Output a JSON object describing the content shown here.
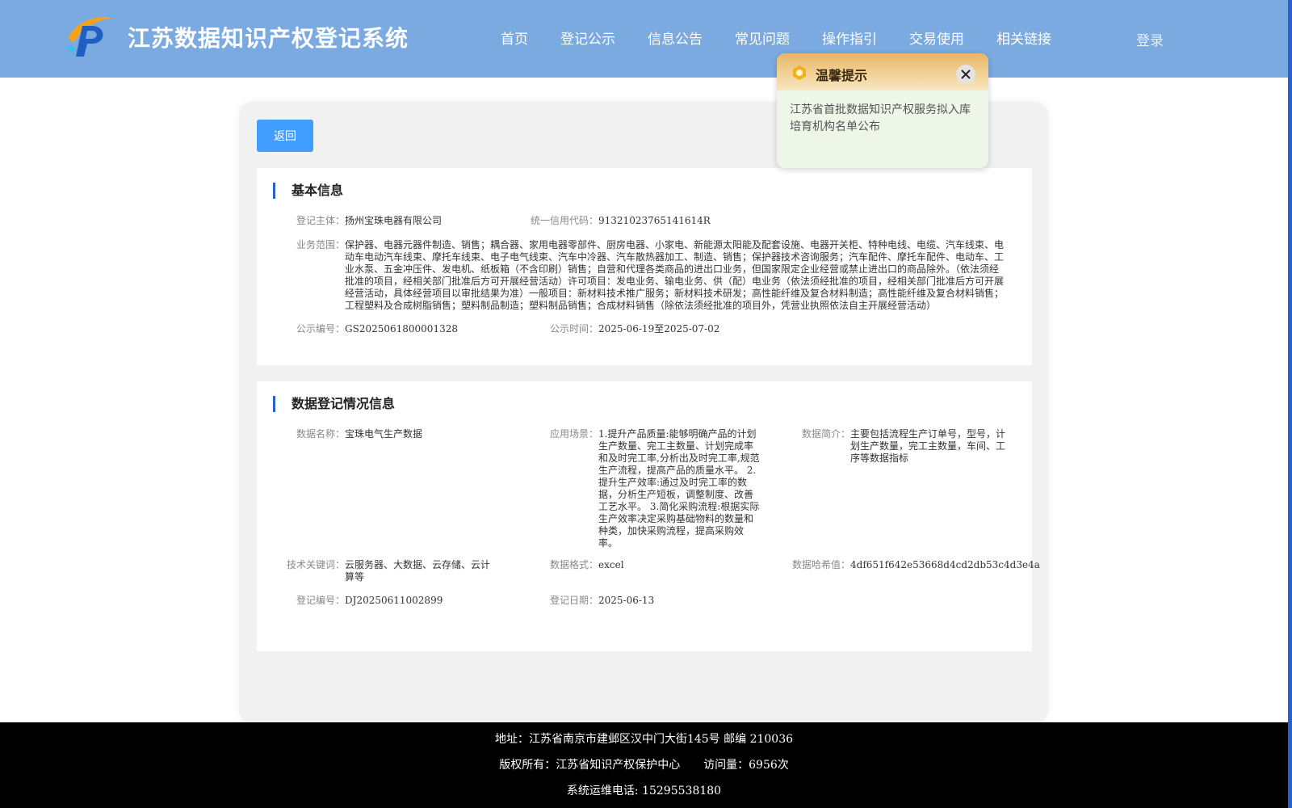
{
  "header": {
    "title": "江苏数据知识产权登记系统",
    "nav": [
      "首页",
      "登记公示",
      "信息公告",
      "常见问题",
      "操作指引",
      "交易使用",
      "相关链接"
    ],
    "login_label": "登录"
  },
  "actions": {
    "back_label": "返回"
  },
  "basic_info": {
    "title": "基本信息",
    "subject_label": "登记主体：",
    "subject": "扬州宝珠电器有限公司",
    "credit_code_label": "统一信用代码：",
    "credit_code": "91321023765141614R",
    "scope_label": "业务范围：",
    "scope": "保护器、电器元器件制造、销售；耦合器、家用电器零部件、厨房电器、小家电、新能源太阳能及配套设施、电器开关柜、特种电线、电缆、汽车线束、电动车电动汽车线束、摩托车线束、电子电气线束、汽车中冷器、汽车散热器加工、制造、销售；保护器技术咨询服务；汽车配件、摩托车配件、电动车、工业水泵、五金冲压件、发电机、纸板箱（不含印刷）销售；自营和代理各类商品的进出口业务，但国家限定企业经营或禁止进出口的商品除外。（依法须经批准的项目，经相关部门批准后方可开展经营活动）许可项目：发电业务、输电业务、供（配）电业务（依法须经批准的项目，经相关部门批准后方可开展经营活动，具体经营项目以审批结果为准）一般项目：新材料技术推广服务；新材料技术研发；高性能纤维及复合材料制造；高性能纤维及复合材料销售；工程塑料及合成树脂销售；塑料制品制造；塑料制品销售；合成材料销售（除依法须经批准的项目外，凭营业执照依法自主开展经营活动）",
    "pub_no_label": "公示编号：",
    "pub_no": "GS2025061800001328",
    "pub_time_label": "公示时间：",
    "pub_time": "2025-06-19至2025-07-02"
  },
  "data_info": {
    "title": "数据登记情况信息",
    "name_label": "数据名称：",
    "name": "宝珠电气生产数据",
    "scene_label": "应用场景：",
    "scene": "1.提升产品质量:能够明确产品的计划生产数量、完工主数量、计划完成率和及时完工率,分析出及时完工率,规范生产流程，提高产品的质量水平。 2.提升生产效率:通过及时完工率的数据，分析生产短板，调整制度、改善工艺水平。 3.简化采购流程:根据实际生产效率决定采购基础物料的数量和种类，加快采购流程，提高采购效率。",
    "intro_label": "数据简介：",
    "intro": "主要包括流程生产订单号，型号，计划生产数量，完工主数量，车间、工序等数据指标",
    "keywords_label": "技术关键词：",
    "keywords": "云服务器、大数据、云存储、云计算等",
    "format_label": "数据格式：",
    "format": "excel",
    "hash_label": "数据哈希值：",
    "hash": "4df651f642e53668d4cd2db53c4d3e4a",
    "reg_no_label": "登记编号：",
    "reg_no": "DJ20250611002899",
    "reg_date_label": "登记日期：",
    "reg_date": "2025-06-13"
  },
  "popup": {
    "title": "温馨提示",
    "message": "江苏省首批数据知识产权服务拟入库培育机构名单公布"
  },
  "footer": {
    "address": "地址：江苏省南京市建邺区汉中门大街145号 邮编 210036",
    "copyright": "版权所有：江苏省知识产权保护中心",
    "visits": "访问量：6956次",
    "phone": "系统运维电话: 15295538180"
  },
  "colors": {
    "header_bg": "#7aaae0",
    "button_blue": "#409eff",
    "accent_bar": "#2a5fd0",
    "footer_bg": "#000000"
  }
}
